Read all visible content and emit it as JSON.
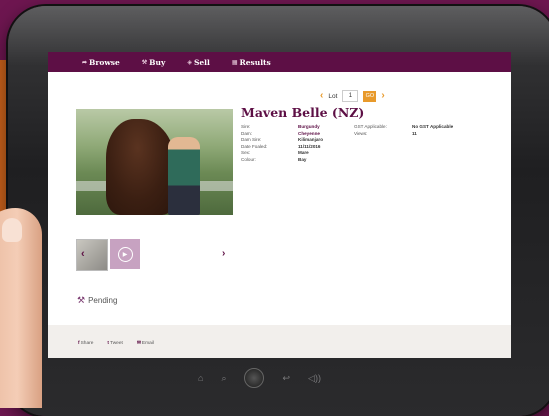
{
  "nav": {
    "items": [
      {
        "label": "Browse",
        "icon": "arrow-icon"
      },
      {
        "label": "Buy",
        "icon": "hammer-icon"
      },
      {
        "label": "Sell",
        "icon": "tag-icon"
      },
      {
        "label": "Results",
        "icon": "grid-icon"
      }
    ]
  },
  "lot": {
    "label": "Lot",
    "value": "1",
    "go": "GO"
  },
  "horse": {
    "name": "Maven Belle (NZ)",
    "details": [
      {
        "k": "Sire:",
        "v": "Burgundy"
      },
      {
        "k": "Dam:",
        "v": "Cheyenne"
      },
      {
        "k": "Dam Sire:",
        "v": "Kilimanjaro"
      },
      {
        "k": "Date Foaled:",
        "v": "11/11/2016"
      },
      {
        "k": "Sex:",
        "v": "Mare"
      },
      {
        "k": "Colour:",
        "v": "Bay"
      }
    ],
    "extra": [
      {
        "k": "GST Applicable:",
        "v": "No GST Applicable"
      },
      {
        "k": "Views:",
        "v": "11"
      }
    ]
  },
  "status": {
    "label": "Pending"
  },
  "share": {
    "share": "Share",
    "tweet": "Tweet",
    "email": "Email"
  },
  "colors": {
    "brand": "#5d0f45",
    "accent": "#e89a2b"
  }
}
